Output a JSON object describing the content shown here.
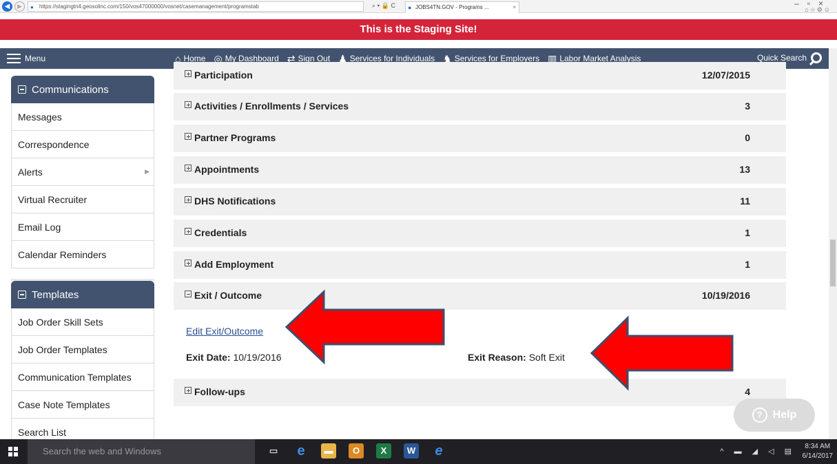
{
  "browser": {
    "url": "https://stagingtn4.geosolinc.com/150/vos47000000/vosnet/casemanagement/programstab",
    "tab_title": "JOBS4TN.GOV - Programs ...",
    "addr_tools": "⌕ ▾ 🔒 C"
  },
  "banner": {
    "text": "This is the Staging Site!"
  },
  "nav": {
    "menu_label": "Menu",
    "links": [
      {
        "icon": "⌂",
        "label": "Home"
      },
      {
        "icon": "◎",
        "label": "My Dashboard"
      },
      {
        "icon": "⇄",
        "label": "Sign Out"
      },
      {
        "icon": "♟",
        "label": "Services for Individuals"
      },
      {
        "icon": "♞",
        "label": "Services for Employers"
      },
      {
        "icon": "▥",
        "label": "Labor Market Analysis"
      }
    ],
    "quick_search": "Quick Search"
  },
  "sidebar": {
    "communications": {
      "title": "Communications",
      "items": [
        "Messages",
        "Correspondence",
        "Alerts",
        "Virtual Recruiter",
        "Email Log",
        "Calendar Reminders"
      ]
    },
    "templates": {
      "title": "Templates",
      "items": [
        "Job Order Skill Sets",
        "Job Order Templates",
        "Communication Templates",
        "Case Note Templates",
        "Search List"
      ]
    }
  },
  "sections": [
    {
      "label": "Participation",
      "value": "12/07/2015",
      "expanded": false
    },
    {
      "label": "Activities / Enrollments / Services",
      "value": "3",
      "expanded": false
    },
    {
      "label": "Partner Programs",
      "value": "0",
      "expanded": false
    },
    {
      "label": "Appointments",
      "value": "13",
      "expanded": false
    },
    {
      "label": "DHS Notifications",
      "value": "11",
      "expanded": false
    },
    {
      "label": "Credentials",
      "value": "1",
      "expanded": false
    },
    {
      "label": "Add Employment",
      "value": "1",
      "expanded": false
    },
    {
      "label": "Exit / Outcome",
      "value": "10/19/2016",
      "expanded": true
    }
  ],
  "exit": {
    "edit_link": "Edit Exit/Outcome",
    "date_label": "Exit Date:",
    "date_value": "10/19/2016",
    "reason_label": "Exit Reason:",
    "reason_value": "Soft Exit"
  },
  "followups": {
    "label": "Follow-ups",
    "value": "4"
  },
  "help": {
    "label": "Help",
    "glyph": "?"
  },
  "taskbar": {
    "search_placeholder": "Search the web and Windows",
    "time": "8:34 AM",
    "date": "6/14/2017"
  },
  "colors": {
    "banner": "#d4243a",
    "nav": "#41536e",
    "arrow": "#ff0000",
    "arrow_outline": "#3d4e6b",
    "link": "#2a4f8f"
  }
}
